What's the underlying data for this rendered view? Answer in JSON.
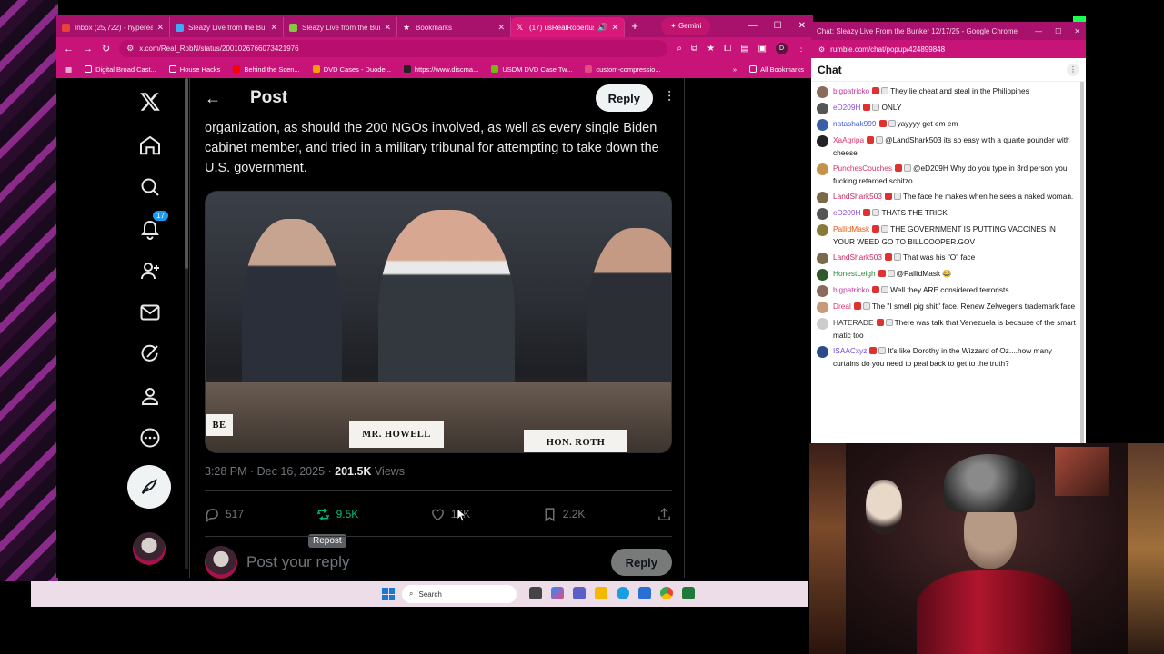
{
  "tabs": [
    {
      "label": "Inbox (25,722) - hyperea...",
      "fav_color": "#ea4335"
    },
    {
      "label": "Sleazy Live from the Bunk",
      "fav_color": "#3fa9f5"
    },
    {
      "label": "Sleazy Live from the Bunk",
      "fav_color": "#85c742"
    },
    {
      "label": "Bookmarks",
      "fav_color": "#ffffff"
    },
    {
      "label": "(17) usRealRobertus o",
      "fav_color": "#111111"
    }
  ],
  "gemini_label": "Gemini",
  "url": "x.com/Real_RobN/status/2001026766073421976",
  "profile_letter": "D",
  "bookmarks": [
    {
      "label": "Digital Broad Cast..."
    },
    {
      "label": "House Hacks"
    },
    {
      "label": "Behind the Scen..."
    },
    {
      "label": "DVD Cases - Duode..."
    },
    {
      "label": "https://www.discma..."
    },
    {
      "label": "USDM DVD Case Tw..."
    },
    {
      "label": "custom-compressio..."
    }
  ],
  "all_bookmarks": "All Bookmarks",
  "nav": {
    "notifications_badge": "17"
  },
  "post": {
    "header_title": "Post",
    "reply_button": "Reply",
    "text": "organization, as should the 200 NGOs involved, as well as every single Biden cabinet member, and tried in a military tribunal for attempting to take down the U.S. government.",
    "nameplate_left": "BE",
    "nameplate_center": "MR. HOWELL",
    "nameplate_right": "HON. ROTH",
    "time": "3:28 PM · Dec 16, 2025 · ",
    "views_count": "201.5K",
    "views_label": " Views",
    "replies": "517",
    "reposts": "9.5K",
    "likes": "16K",
    "bookmarks": "2.2K",
    "tooltip": "Repost",
    "reply_placeholder": "Post your reply",
    "reply_submit": "Reply"
  },
  "taskbar": {
    "search_label": "Search"
  },
  "chat": {
    "window_title": "Chat: Sleazy Live From the Bunker 12/17/25 - Google Chrome",
    "url": "rumble.com/chat/popup/424899848",
    "heading": "Chat",
    "messages": [
      {
        "user": "bigpatricko",
        "color": "#c0359a",
        "av": "#8a6a5a",
        "text": "They lie cheat and steal in the Philippines"
      },
      {
        "user": "eD209H",
        "color": "#8a4fd8",
        "av": "#555555",
        "text": "ONLY"
      },
      {
        "user": "natashak999",
        "color": "#3b5bdb",
        "av": "#3a5fa8",
        "text": "yayyyy get em em"
      },
      {
        "user": "XaAgripa",
        "color": "#d6336c",
        "av": "#222222",
        "text": "@LandShark503 its so easy with a quarte pounder with cheese"
      },
      {
        "user": "PunchesCouches",
        "color": "#d6336c",
        "av": "#c6924a",
        "text": "@eD209H Why do you type in 3rd person you fucking retarded schitzo"
      },
      {
        "user": "LandShark503",
        "color": "#c2255c",
        "av": "#7a6a4a",
        "text": "The face he makes when he sees a naked woman."
      },
      {
        "user": "eD209H",
        "color": "#8a4fd8",
        "av": "#555555",
        "text": "THATS THE TRICK"
      },
      {
        "user": "PallidMask",
        "color": "#e8590c",
        "av": "#8a7a3a",
        "text": "THE GOVERNMENT IS PUTTING VACCINES IN YOUR WEED GO TO BILLCOOPER.GOV"
      },
      {
        "user": "LandShark503",
        "color": "#c2255c",
        "av": "#7a6a4a",
        "text": "That was his \"O\" face"
      },
      {
        "user": "HonestLeigh",
        "color": "#2b8a3e",
        "av": "#2f5a2a",
        "text": "@PallidMask 😂"
      },
      {
        "user": "bigpatricko",
        "color": "#c0359a",
        "av": "#8a6a5a",
        "text": "Well they ARE considered terrorists"
      },
      {
        "user": "Dreal",
        "color": "#d6336c",
        "av": "#c89a7a",
        "text": "The \"I smell pig shit\" face. Renew Zelweger's trademark face"
      },
      {
        "user": "HATERADE",
        "color": "#333333",
        "av": "#cccccc",
        "text": "There was talk that Venezuela is because of the smart matic too"
      },
      {
        "user": "ISAACxyz",
        "color": "#7048e8",
        "av": "#2a4a8a",
        "text": "It's like Dorothy in the Wizzard of Oz....how many curtains do you need to peal back to get to the truth?"
      }
    ]
  }
}
